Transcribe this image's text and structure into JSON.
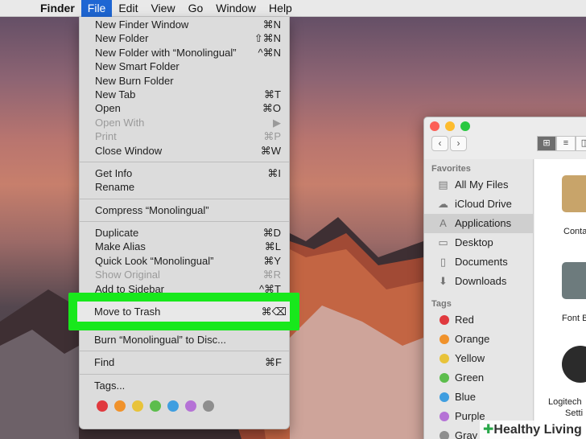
{
  "menubar": {
    "apple_icon": "apple-icon",
    "items": [
      {
        "label": "Finder",
        "bold": true
      },
      {
        "label": "File",
        "active": true
      },
      {
        "label": "Edit"
      },
      {
        "label": "View"
      },
      {
        "label": "Go"
      },
      {
        "label": "Window"
      },
      {
        "label": "Help"
      }
    ]
  },
  "file_menu": {
    "group1": [
      {
        "label": "New Finder Window",
        "shortcut": "⌘N",
        "disabled": false
      },
      {
        "label": "New Folder",
        "shortcut": "⇧⌘N",
        "disabled": false
      },
      {
        "label": "New Folder with “Monolingual”",
        "shortcut": "^⌘N",
        "disabled": false
      },
      {
        "label": "New Smart Folder",
        "shortcut": "",
        "disabled": false
      },
      {
        "label": "New Burn Folder",
        "shortcut": "",
        "disabled": false
      },
      {
        "label": "New Tab",
        "shortcut": "⌘T",
        "disabled": false
      },
      {
        "label": "Open",
        "shortcut": "⌘O",
        "disabled": false
      },
      {
        "label": "Open With",
        "shortcut": "▶",
        "disabled": true
      },
      {
        "label": "Print",
        "shortcut": "⌘P",
        "disabled": true
      },
      {
        "label": "Close Window",
        "shortcut": "⌘W",
        "disabled": false
      }
    ],
    "group2": [
      {
        "label": "Get Info",
        "shortcut": "⌘I",
        "disabled": false
      },
      {
        "label": "Rename",
        "shortcut": "",
        "disabled": false
      }
    ],
    "group3": [
      {
        "label": "Compress “Monolingual”",
        "shortcut": "",
        "disabled": false
      }
    ],
    "group4": [
      {
        "label": "Duplicate",
        "shortcut": "⌘D",
        "disabled": false
      },
      {
        "label": "Make Alias",
        "shortcut": "⌘L",
        "disabled": false
      },
      {
        "label": "Quick Look “Monolingual”",
        "shortcut": "⌘Y",
        "disabled": false
      },
      {
        "label": "Show Original",
        "shortcut": "⌘R",
        "disabled": true
      },
      {
        "label": "Add to Sidebar",
        "shortcut": "^⌘T",
        "disabled": false
      }
    ],
    "highlighted": {
      "label": "Move to Trash",
      "shortcut": "⌘⌫"
    },
    "group5": [
      {
        "label": "Burn “Monolingual” to Disc...",
        "shortcut": "",
        "disabled": false
      }
    ],
    "group6": [
      {
        "label": "Find",
        "shortcut": "⌘F",
        "disabled": false
      }
    ],
    "group7": [
      {
        "label": "Tags...",
        "shortcut": "",
        "disabled": false
      }
    ],
    "tag_colors": [
      "#e0393e",
      "#f0922b",
      "#e8c33a",
      "#5cbd4c",
      "#3f9ee0",
      "#b572d6",
      "#8e8e8e"
    ],
    "highlight_color": "#18e81c"
  },
  "finder_window": {
    "favorites_header": "Favorites",
    "favorites": [
      {
        "label": "All My Files",
        "icon": "all-files-icon",
        "glyph": "▤"
      },
      {
        "label": "iCloud Drive",
        "icon": "cloud-icon",
        "glyph": "☁"
      },
      {
        "label": "Applications",
        "icon": "applications-icon",
        "glyph": "A",
        "selected": true
      },
      {
        "label": "Desktop",
        "icon": "desktop-icon",
        "glyph": "▭"
      },
      {
        "label": "Documents",
        "icon": "documents-icon",
        "glyph": "▯"
      },
      {
        "label": "Downloads",
        "icon": "downloads-icon",
        "glyph": "⬇"
      }
    ],
    "tags_header": "Tags",
    "tags": [
      {
        "label": "Red",
        "color": "#e0393e"
      },
      {
        "label": "Orange",
        "color": "#f0922b"
      },
      {
        "label": "Yellow",
        "color": "#e8c33a"
      },
      {
        "label": "Green",
        "color": "#5cbd4c"
      },
      {
        "label": "Blue",
        "color": "#3f9ee0"
      },
      {
        "label": "Purple",
        "color": "#b572d6"
      },
      {
        "label": "Gray",
        "color": "#8e8e8e"
      }
    ],
    "apps": [
      {
        "label": "Conta",
        "color": "#c8a46a"
      },
      {
        "label": "Font B",
        "color": "#6d7b7d"
      },
      {
        "label": "Logitech",
        "label2": "Setti",
        "color": "#2b2b2b"
      }
    ]
  },
  "watermark": {
    "text": "Healthy Living"
  }
}
